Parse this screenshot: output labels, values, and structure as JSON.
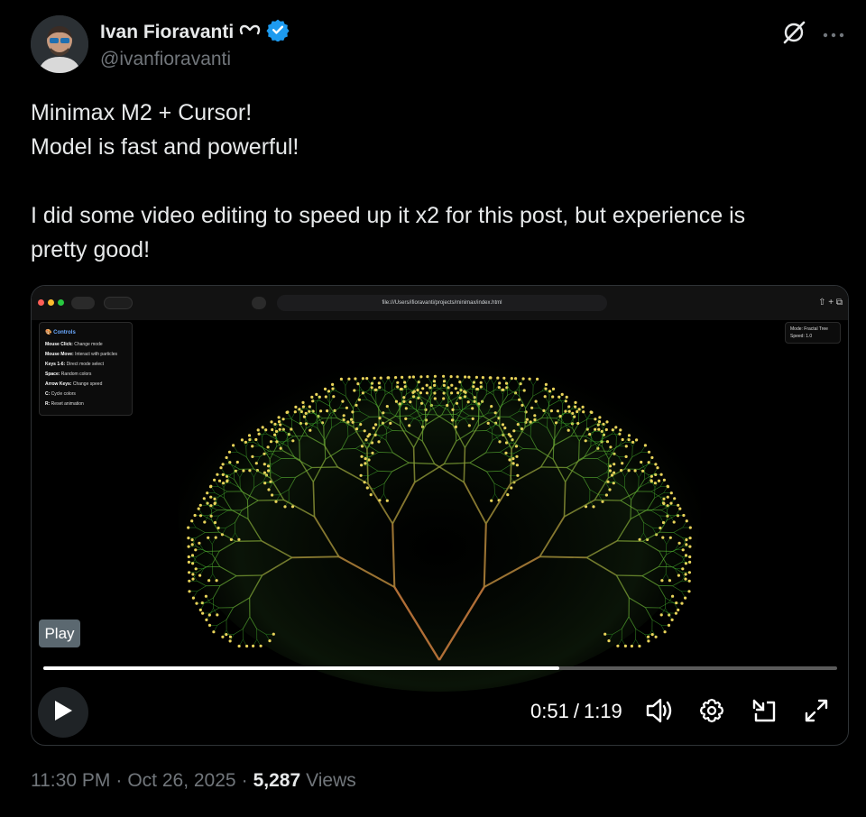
{
  "author": {
    "name": "Ivan Fioravanti",
    "handle": "@ivanfioravanti",
    "verified": true,
    "accent": "#1d9bf0"
  },
  "tweet": {
    "lines": [
      "Minimax M2 + Cursor!",
      "Model is fast and powerful!",
      "",
      "I did some video editing to speed up it x2 for this post, but experience is",
      "pretty good!"
    ]
  },
  "video": {
    "browser_url": "file:///Users/ifioravanti/projects/minimax/index.html",
    "controls_panel": {
      "title": "🎨 Controls",
      "items": [
        {
          "key": "Mouse Click:",
          "desc": "Change mode"
        },
        {
          "key": "Mouse Move:",
          "desc": "Interact with particles"
        },
        {
          "key": "Keys 1-6:",
          "desc": "Direct mode select"
        },
        {
          "key": "Space:",
          "desc": "Random colors"
        },
        {
          "key": "Arrow Keys:",
          "desc": "Change speed"
        },
        {
          "key": "C:",
          "desc": "Cycle colors"
        },
        {
          "key": "R:",
          "desc": "Reset animation"
        }
      ]
    },
    "mode_panel": {
      "mode": "Mode: Fractal Tree",
      "speed": "Speed: 1.0"
    },
    "play_badge": "Play",
    "current_time": "0:51",
    "separator": "/",
    "duration": "1:19",
    "progress_fraction": 0.65,
    "icons": [
      "play-icon",
      "volume-icon",
      "settings-icon",
      "pip-icon",
      "fullscreen-icon"
    ]
  },
  "footer": {
    "time": "11:30 PM",
    "sep1": "·",
    "date": "Oct 26, 2025",
    "sep2": "·",
    "views_count": "5,287",
    "views_label": "Views"
  },
  "top_icons": [
    "grok-icon",
    "more-icon"
  ]
}
